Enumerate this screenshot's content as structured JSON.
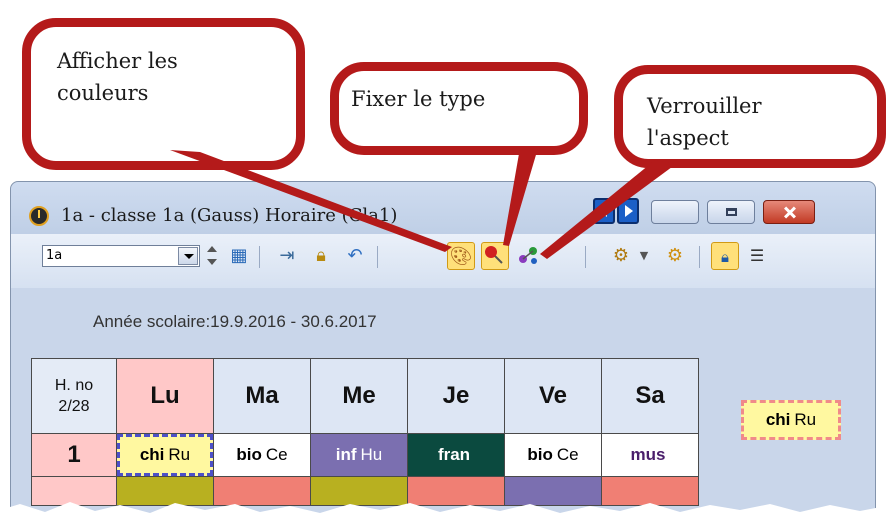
{
  "callouts": {
    "colors": [
      "Afficher les",
      "couleurs"
    ],
    "fix_type": "Fixer le type",
    "lock": [
      "Verrouiller",
      "l'aspect"
    ]
  },
  "window": {
    "title": "1a - classe 1a (Gauss)  Horaire  (Cla1)"
  },
  "toolbar": {
    "class_value": "1a",
    "icons": [
      "spinner-icon",
      "grid-icon",
      "export-icon",
      "lock-icon",
      "undo-icon",
      "palette-icon",
      "pin-icon",
      "molecule-icon",
      "settings-dropdown-icon",
      "gear-icon",
      "lock-view-icon",
      "list-menu-icon"
    ]
  },
  "header": {
    "school_year": "Année scolaire:19.9.2016 - 30.6.2017"
  },
  "timetable": {
    "corner": [
      "H. no",
      "2/28"
    ],
    "days": [
      "Lu",
      "Ma",
      "Me",
      "Je",
      "Ve",
      "Sa"
    ],
    "row1": {
      "number": "1",
      "lessons": [
        {
          "subject": "chi",
          "teacher": "Ru"
        },
        {
          "subject": "bio",
          "teacher": "Ce"
        },
        {
          "subject": "inf",
          "teacher": "Hu"
        },
        {
          "subject": "fran",
          "teacher": ""
        },
        {
          "subject": "bio",
          "teacher": "Ce"
        },
        {
          "subject": "mus",
          "teacher": ""
        }
      ]
    },
    "legend": {
      "subject": "chi",
      "teacher": "Ru"
    }
  },
  "colors": {
    "callout_border": "#b41a1a",
    "window_bg": "#c9d6ea",
    "active_toolbar": "#ffe07a"
  }
}
